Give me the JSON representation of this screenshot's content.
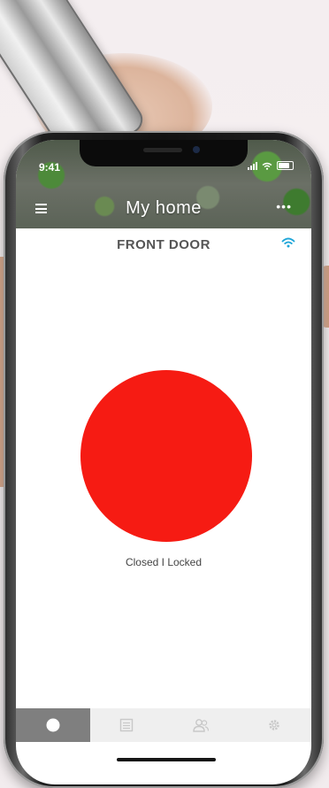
{
  "status_bar": {
    "time": "9:41"
  },
  "header": {
    "title": "My home"
  },
  "door": {
    "name": "FRONT DOOR",
    "status": "Closed I Locked",
    "status_color": "#f61b13"
  },
  "tabs": [
    {
      "icon": "circle-icon",
      "active": true
    },
    {
      "icon": "list-icon",
      "active": false
    },
    {
      "icon": "users-icon",
      "active": false
    },
    {
      "icon": "gear-icon",
      "active": false
    }
  ],
  "colors": {
    "accent_wifi": "#1fa6d8",
    "active_tab": "#7f7f7f",
    "tabbar_bg": "#efefef"
  }
}
